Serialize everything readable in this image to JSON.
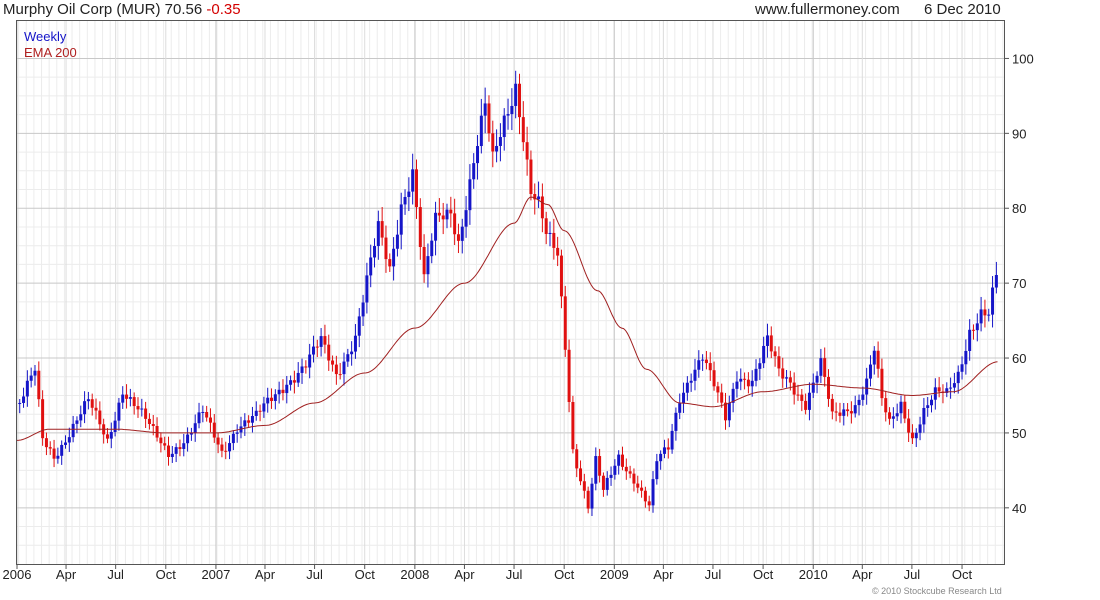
{
  "header": {
    "title": "Murphy Oil Corp (MUR) 70.56",
    "change": "-0.35",
    "site": "www.fullermoney.com",
    "date": "6 Dec 2010"
  },
  "footer": {
    "copyright": "© 2010 Stockcube Research Ltd"
  },
  "chart_data": {
    "type": "candlestick",
    "legend": [
      "Weekly",
      "EMA 200"
    ],
    "legend_placement": "top-left",
    "colors": {
      "up": "#1515c8",
      "down": "#e01010",
      "ema": "#a02020",
      "grid": "#d8d8d8"
    },
    "grid": true,
    "y_axis": {
      "position": "right",
      "ylim": [
        32.5,
        105
      ],
      "ticks": [
        40,
        50,
        60,
        70,
        80,
        90,
        100
      ]
    },
    "x_axis": {
      "xlim": [
        "2006-01-01",
        "2010-12-17"
      ],
      "ticks": [
        {
          "date": "2006-01-01",
          "label": "2006"
        },
        {
          "date": "2006-04-01",
          "label": "Apr"
        },
        {
          "date": "2006-07-01",
          "label": "Jul"
        },
        {
          "date": "2006-10-01",
          "label": "Oct"
        },
        {
          "date": "2007-01-01",
          "label": "2007"
        },
        {
          "date": "2007-04-01",
          "label": "Apr"
        },
        {
          "date": "2007-07-01",
          "label": "Jul"
        },
        {
          "date": "2007-10-01",
          "label": "Oct"
        },
        {
          "date": "2008-01-01",
          "label": "2008"
        },
        {
          "date": "2008-04-01",
          "label": "Apr"
        },
        {
          "date": "2008-07-01",
          "label": "Jul"
        },
        {
          "date": "2008-10-01",
          "label": "Oct"
        },
        {
          "date": "2009-01-01",
          "label": "2009"
        },
        {
          "date": "2009-04-01",
          "label": "Apr"
        },
        {
          "date": "2009-07-01",
          "label": "Jul"
        },
        {
          "date": "2009-10-01",
          "label": "Oct"
        },
        {
          "date": "2010-01-01",
          "label": "2010"
        },
        {
          "date": "2010-04-01",
          "label": "Apr"
        },
        {
          "date": "2010-07-01",
          "label": "Jul"
        },
        {
          "date": "2010-10-01",
          "label": "Oct"
        }
      ]
    },
    "price_anchors": [
      [
        "2006-01-06",
        54
      ],
      [
        "2006-02-03",
        58
      ],
      [
        "2006-02-17",
        49
      ],
      [
        "2006-03-10",
        47
      ],
      [
        "2006-04-14",
        51
      ],
      [
        "2006-05-12",
        54
      ],
      [
        "2006-06-16",
        49
      ],
      [
        "2006-07-14",
        56
      ],
      [
        "2006-08-11",
        53
      ],
      [
        "2006-09-08",
        50
      ],
      [
        "2006-10-06",
        47.5
      ],
      [
        "2006-11-10",
        49.5
      ],
      [
        "2006-12-08",
        52.5
      ],
      [
        "2007-01-12",
        47.5
      ],
      [
        "2007-02-09",
        51
      ],
      [
        "2007-03-16",
        52
      ],
      [
        "2007-04-13",
        54.5
      ],
      [
        "2007-05-11",
        57
      ],
      [
        "2007-06-15",
        59
      ],
      [
        "2007-07-13",
        62
      ],
      [
        "2007-08-10",
        58
      ],
      [
        "2007-09-14",
        63
      ],
      [
        "2007-10-05",
        70
      ],
      [
        "2007-10-26",
        77
      ],
      [
        "2007-11-16",
        72
      ],
      [
        "2007-12-07",
        81
      ],
      [
        "2007-12-28",
        85
      ],
      [
        "2008-01-18",
        70
      ],
      [
        "2008-02-08",
        78
      ],
      [
        "2008-03-07",
        80
      ],
      [
        "2008-03-21",
        76
      ],
      [
        "2008-04-18",
        86
      ],
      [
        "2008-05-09",
        93
      ],
      [
        "2008-05-23",
        86
      ],
      [
        "2008-06-13",
        92
      ],
      [
        "2008-07-04",
        97
      ],
      [
        "2008-07-18",
        90
      ],
      [
        "2008-08-01",
        82
      ],
      [
        "2008-08-15",
        80
      ],
      [
        "2008-08-29",
        76
      ],
      [
        "2008-09-19",
        74
      ],
      [
        "2008-10-03",
        62
      ],
      [
        "2008-10-17",
        48
      ],
      [
        "2008-10-31",
        44
      ],
      [
        "2008-11-14",
        40
      ],
      [
        "2008-11-28",
        46
      ],
      [
        "2008-12-12",
        42
      ],
      [
        "2009-01-09",
        47
      ],
      [
        "2009-02-06",
        44
      ],
      [
        "2009-03-06",
        40
      ],
      [
        "2009-03-20",
        46
      ],
      [
        "2009-04-10",
        48
      ],
      [
        "2009-05-01",
        55
      ],
      [
        "2009-05-22",
        58
      ],
      [
        "2009-06-12",
        60
      ],
      [
        "2009-07-03",
        56
      ],
      [
        "2009-07-24",
        52
      ],
      [
        "2009-08-14",
        58
      ],
      [
        "2009-09-11",
        57
      ],
      [
        "2009-10-09",
        62
      ],
      [
        "2009-10-30",
        58
      ],
      [
        "2009-11-20",
        57
      ],
      [
        "2009-12-18",
        54
      ],
      [
        "2010-01-15",
        59
      ],
      [
        "2010-02-05",
        52
      ],
      [
        "2010-02-26",
        53
      ],
      [
        "2010-03-19",
        54
      ],
      [
        "2010-04-09",
        57
      ],
      [
        "2010-04-23",
        61
      ],
      [
        "2010-05-07",
        54
      ],
      [
        "2010-05-21",
        51
      ],
      [
        "2010-06-11",
        54
      ],
      [
        "2010-07-02",
        49.5
      ],
      [
        "2010-07-23",
        53
      ],
      [
        "2010-08-13",
        55
      ],
      [
        "2010-09-03",
        55
      ],
      [
        "2010-09-24",
        58
      ],
      [
        "2010-10-15",
        64
      ],
      [
        "2010-11-05",
        66
      ],
      [
        "2010-11-19",
        65.5
      ],
      [
        "2010-12-03",
        70.56
      ]
    ],
    "ema200": [
      [
        "2006-01-01",
        49
      ],
      [
        "2006-03-01",
        50.5
      ],
      [
        "2006-07-01",
        50.5
      ],
      [
        "2006-10-01",
        50
      ],
      [
        "2007-01-01",
        50
      ],
      [
        "2007-04-01",
        51
      ],
      [
        "2007-07-01",
        54
      ],
      [
        "2007-10-01",
        58
      ],
      [
        "2008-01-01",
        64
      ],
      [
        "2008-04-01",
        70
      ],
      [
        "2008-07-01",
        78
      ],
      [
        "2008-08-01",
        81.5
      ],
      [
        "2008-09-01",
        80.5
      ],
      [
        "2008-10-01",
        77
      ],
      [
        "2008-12-01",
        69
      ],
      [
        "2009-01-15",
        64
      ],
      [
        "2009-03-01",
        58.5
      ],
      [
        "2009-05-01",
        54
      ],
      [
        "2009-07-01",
        53.5
      ],
      [
        "2009-10-01",
        55.5
      ],
      [
        "2010-01-01",
        56.5
      ],
      [
        "2010-04-01",
        56
      ],
      [
        "2010-07-01",
        55
      ],
      [
        "2010-09-15",
        55.5
      ],
      [
        "2010-12-06",
        59.5
      ]
    ]
  }
}
